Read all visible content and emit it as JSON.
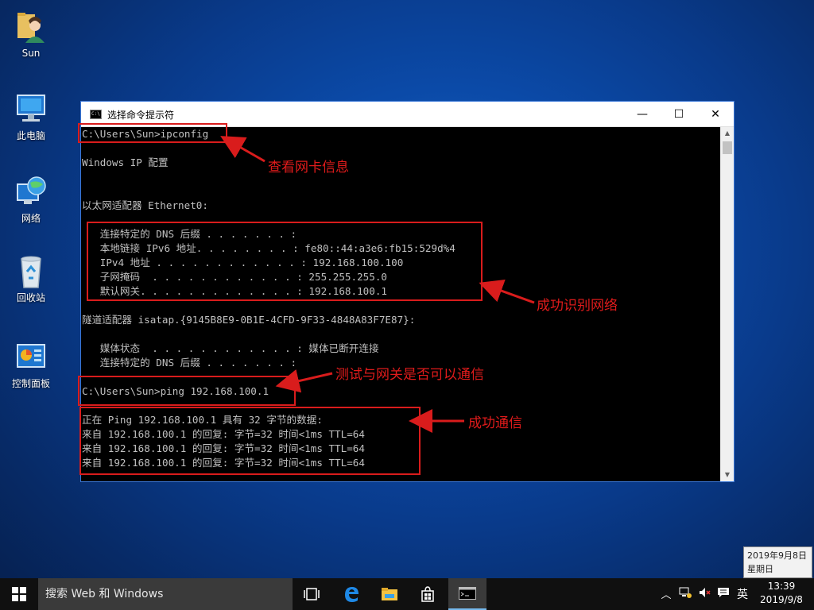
{
  "desktop": {
    "icons": [
      {
        "label": "Sun"
      },
      {
        "label": "此电脑"
      },
      {
        "label": "网络"
      },
      {
        "label": "回收站"
      },
      {
        "label": "控制面板"
      }
    ]
  },
  "window": {
    "title": "选择命令提示符",
    "minimize_glyph": "—",
    "maximize_glyph": "☐",
    "close_glyph": "✕"
  },
  "console": {
    "lines": [
      "C:\\Users\\Sun>ipconfig",
      "Windows IP 配置",
      "以太网适配器 Ethernet0:",
      "   连接特定的 DNS 后缀 . . . . . . . :",
      "   本地链接 IPv6 地址. . . . . . . . : fe80::44:a3e6:fb15:529d%4",
      "   IPv4 地址 . . . . . . . . . . . . : 192.168.100.100",
      "   子网掩码  . . . . . . . . . . . . : 255.255.255.0",
      "   默认网关. . . . . . . . . . . . . : 192.168.100.1",
      "隧道适配器 isatap.{9145B8E9-0B1E-4CFD-9F33-4848A83F7E87}:",
      "   媒体状态  . . . . . . . . . . . . : 媒体已断开连接",
      "   连接特定的 DNS 后缀 . . . . . . . :",
      "C:\\Users\\Sun>ping 192.168.100.1",
      "正在 Ping 192.168.100.1 具有 32 字节的数据:",
      "来自 192.168.100.1 的回复: 字节=32 时间<1ms TTL=64",
      "来自 192.168.100.1 的回复: 字节=32 时间<1ms TTL=64",
      "来自 192.168.100.1 的回复: 字节=32 时间<1ms TTL=64"
    ]
  },
  "annotations": {
    "ipconfig": "查看网卡信息",
    "network": "成功识别网络",
    "gateway_test": "测试与网关是否可以通信",
    "success": "成功通信",
    "color": "#e01b1b"
  },
  "tooltip": {
    "date": "2019年9月8日",
    "weekday": "星期日"
  },
  "taskbar": {
    "search_placeholder": "搜索 Web 和 Windows",
    "ime": "英",
    "time": "13:39",
    "date": "2019/9/8"
  }
}
